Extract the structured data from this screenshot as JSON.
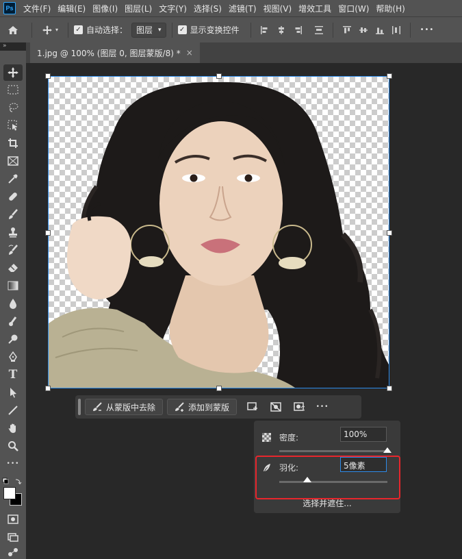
{
  "app": {
    "logo": "Ps"
  },
  "menu": [
    "文件(F)",
    "编辑(E)",
    "图像(I)",
    "图层(L)",
    "文字(Y)",
    "选择(S)",
    "滤镜(T)",
    "视图(V)",
    "增效工具",
    "窗口(W)",
    "帮助(H)"
  ],
  "options": {
    "auto_select_label": "自动选择：",
    "auto_select_target": "图层",
    "show_transform_label": "显示变换控件",
    "more_glyph": "•••"
  },
  "collapse_glyph": "»",
  "tab": {
    "title": "1.jpg @ 100% (图层 0, 图层蒙版/8) *",
    "close": "×"
  },
  "toolbar": {
    "tools": [
      "move-tool-icon",
      "marquee-tool-icon",
      "lasso-tool-icon",
      "object-select-tool-icon",
      "crop-tool-icon",
      "frame-tool-icon",
      "eyedropper-tool-icon",
      "healing-brush-icon",
      "brush-tool-icon",
      "clone-stamp-icon",
      "history-brush-icon",
      "eraser-tool-icon",
      "gradient-tool-icon",
      "blur-tool-icon",
      "smudge-tool-icon",
      "dodge-tool-icon",
      "pen-tool-icon",
      "type-tool-icon",
      "path-select-icon",
      "line-tool-icon",
      "hand-tool-icon",
      "zoom-tool-icon",
      "more-tools-icon"
    ],
    "type_glyph": "T",
    "more_glyph": "•••"
  },
  "taskbar": {
    "subtract_label": "从蒙版中去除",
    "add_label": "添加到蒙版",
    "more_glyph": "•••"
  },
  "mask_panel": {
    "density_label": "密度:",
    "density_value": "100%",
    "density_level": 1.0,
    "feather_label": "羽化:",
    "feather_value": "5像素",
    "feather_level": 0.26,
    "select_and_mask": "选择并遮住..."
  },
  "colors": {
    "accent": "#2d8ceb",
    "highlight": "#e8262c",
    "ui_bg": "#535353",
    "canvas_bg": "#282828"
  }
}
